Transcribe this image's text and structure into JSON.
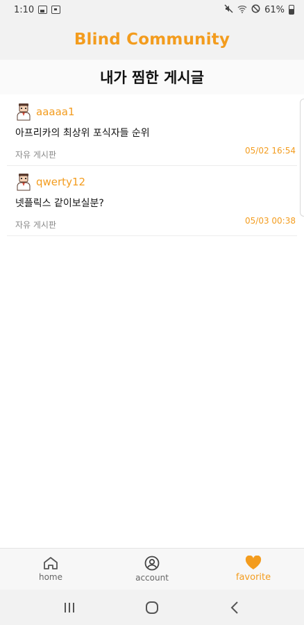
{
  "status_bar": {
    "time": "1:10",
    "battery": "61%",
    "icons": [
      "image-icon",
      "notification-box-icon",
      "mute-icon",
      "wifi-icon",
      "no-sim-icon",
      "battery-icon"
    ]
  },
  "app": {
    "title": "Blind Community",
    "accent_color": "#f39c1e"
  },
  "page": {
    "title": "내가 찜한 게시글"
  },
  "posts": [
    {
      "author": "aaaaa1",
      "title": "아프리카의 최상위 포식자들 순위",
      "board": "자유 게시판",
      "date": "05/02 16:54",
      "avatar_icon": "user-avatar-icon"
    },
    {
      "author": "qwerty12",
      "title": "넷플릭스 같이보실분?",
      "board": "자유 게시판",
      "date": "05/03 00:38",
      "avatar_icon": "user-avatar-icon"
    }
  ],
  "bottom_nav": {
    "items": [
      {
        "label": "home",
        "icon": "home-icon",
        "active": false
      },
      {
        "label": "account",
        "icon": "account-icon",
        "active": false
      },
      {
        "label": "favorite",
        "icon": "heart-icon",
        "active": true
      }
    ]
  },
  "system_nav": {
    "buttons": [
      "recent-apps-icon",
      "home-circle-icon",
      "back-icon"
    ]
  }
}
